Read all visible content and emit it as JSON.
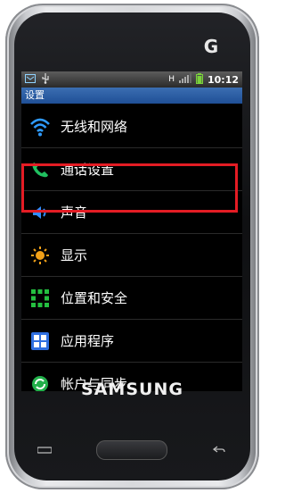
{
  "status_bar": {
    "time": "10:12",
    "network_label": "H"
  },
  "title_bar": {
    "title": "设置"
  },
  "menu": {
    "items": [
      {
        "label": "无线和网络",
        "icon": "wifi-icon"
      },
      {
        "label": "通话设置",
        "icon": "phone-icon"
      },
      {
        "label": "声音",
        "icon": "speaker-icon"
      },
      {
        "label": "显示",
        "icon": "brightness-icon"
      },
      {
        "label": "位置和安全",
        "icon": "location-security-icon"
      },
      {
        "label": "应用程序",
        "icon": "apps-icon"
      },
      {
        "label": "帐户与同步",
        "icon": "sync-icon"
      }
    ],
    "highlighted_item": "声音"
  },
  "device": {
    "brand": "SAMSUNG",
    "top_logo": "G"
  },
  "colors": {
    "highlight_border": "#e41c24",
    "title_bar": "#2b5ea6"
  }
}
